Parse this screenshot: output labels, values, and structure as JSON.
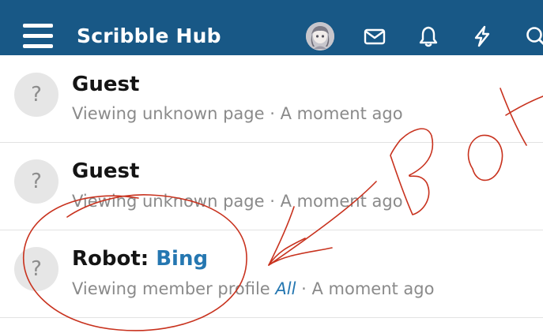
{
  "header": {
    "brand": "Scribble Hub",
    "icons": [
      "menu-icon",
      "user-avatar",
      "inbox-icon",
      "bell-icon",
      "bolt-icon",
      "search-icon"
    ]
  },
  "rows": [
    {
      "avatar": "?",
      "name": "Guest",
      "meta": "Viewing unknown page",
      "separator": " · ",
      "time": "A moment ago"
    },
    {
      "avatar": "?",
      "name": "Guest",
      "meta": "Viewing unknown page",
      "separator": " · ",
      "time": "A moment ago"
    },
    {
      "avatar": "?",
      "name_prefix": "Robot: ",
      "name_link": "Bing",
      "meta": "Viewing member profile ",
      "meta_link": "All",
      "separator": " · ",
      "time": "A moment ago"
    }
  ],
  "annotation": {
    "text": "BOT",
    "color": "#c8321e"
  },
  "colors": {
    "header_bg": "#185886",
    "link": "#2577b1",
    "meta_text": "#8a8a8a",
    "annotation": "#c8321e"
  }
}
